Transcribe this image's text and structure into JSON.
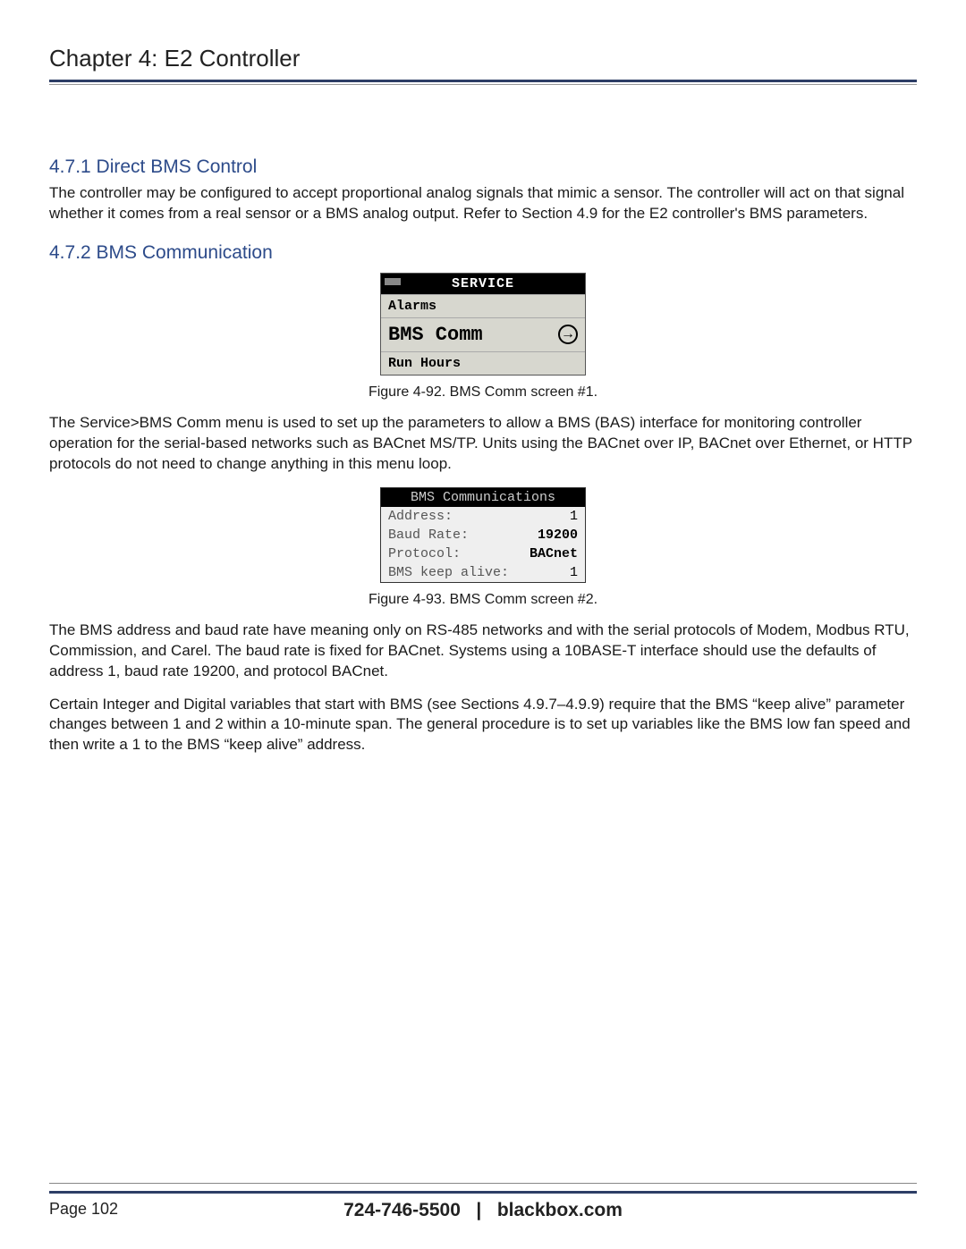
{
  "chapter_title": "Chapter 4: E2 Controller",
  "section_471": {
    "heading": "4.7.1 Direct BMS Control",
    "para": "The controller may be configured to accept proportional analog signals that mimic a sensor. The controller will act on that signal whether it comes from a real sensor or a BMS analog output. Refer to Section 4.9 for the E2 controller's BMS parameters."
  },
  "section_472": {
    "heading": "4.7.2 BMS Communication"
  },
  "lcd1": {
    "header": "SERVICE",
    "row1": "Alarms",
    "row2": "BMS Comm",
    "row3": "Run Hours"
  },
  "fig92_caption": "Figure 4-92. BMS Comm screen #1.",
  "para_after_fig92": "The Service>BMS Comm menu is used to set up the parameters to allow a BMS (BAS) interface for monitoring controller operation for the serial-based networks such as BACnet MS/TP. Units using the BACnet over IP, BACnet over Ethernet, or HTTP protocols do not need to change anything in this menu loop.",
  "lcd2": {
    "header": "BMS Communications",
    "rows": [
      {
        "label": "Address:",
        "value": "1"
      },
      {
        "label": "Baud Rate:",
        "value": "19200"
      },
      {
        "label": "Protocol:",
        "value": "BACnet"
      },
      {
        "label": "BMS keep alive:",
        "value": "1"
      }
    ]
  },
  "fig93_caption": "Figure 4-93. BMS Comm screen #2.",
  "para_after_fig93_1": "The BMS address and baud rate have meaning only on RS-485 networks and with the serial protocols of Modem, Modbus RTU, Commission, and Carel. The baud rate is fixed for BACnet. Systems using a 10BASE-T interface should use the defaults of address 1, baud rate 19200, and protocol BACnet.",
  "para_after_fig93_2": "Certain Integer and Digital variables that start with BMS (see Sections 4.9.7–4.9.9) require that the BMS “keep alive” parameter changes between 1 and 2 within a 10-minute span. The general procedure is to set up variables like the BMS low fan speed and then write a 1 to the BMS “keep alive” address.",
  "footer": {
    "page_label": "Page 102",
    "phone": "724-746-5500",
    "separator": "|",
    "site": "blackbox.com"
  }
}
